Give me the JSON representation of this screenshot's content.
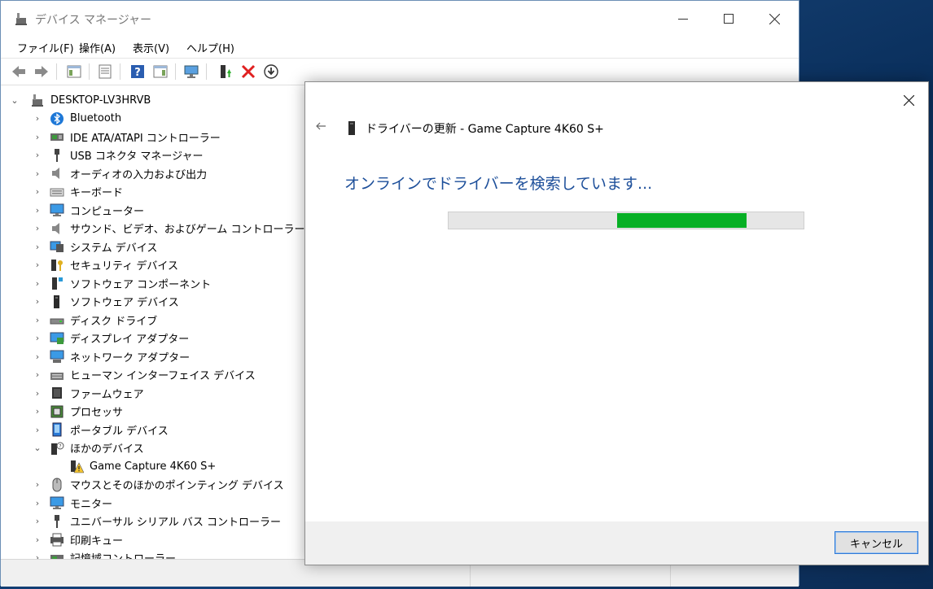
{
  "window": {
    "title": "デバイス マネージャー"
  },
  "menu": [
    "ファイル(F)",
    "操作(A)",
    "表示(V)",
    "ヘルプ(H)"
  ],
  "tree": {
    "root": "DESKTOP-LV3HRVB",
    "items": [
      {
        "label": "Bluetooth",
        "icon": "bluetooth-icon"
      },
      {
        "label": "IDE ATA/ATAPI コントローラー",
        "icon": "ide-controller-icon"
      },
      {
        "label": "USB コネクタ マネージャー",
        "icon": "usb-connector-icon"
      },
      {
        "label": "オーディオの入力および出力",
        "icon": "speaker-icon"
      },
      {
        "label": "キーボード",
        "icon": "keyboard-icon"
      },
      {
        "label": "コンピューター",
        "icon": "computer-icon"
      },
      {
        "label": "サウンド、ビデオ、およびゲーム コントローラー",
        "icon": "sound-icon"
      },
      {
        "label": "システム デバイス",
        "icon": "system-device-icon"
      },
      {
        "label": "セキュリティ デバイス",
        "icon": "security-key-icon"
      },
      {
        "label": "ソフトウェア コンポーネント",
        "icon": "software-component-icon"
      },
      {
        "label": "ソフトウェア デバイス",
        "icon": "software-device-icon"
      },
      {
        "label": "ディスク ドライブ",
        "icon": "disk-drive-icon"
      },
      {
        "label": "ディスプレイ アダプター",
        "icon": "display-adapter-icon"
      },
      {
        "label": "ネットワーク アダプター",
        "icon": "network-adapter-icon"
      },
      {
        "label": "ヒューマン インターフェイス デバイス",
        "icon": "hid-icon"
      },
      {
        "label": "ファームウェア",
        "icon": "firmware-icon"
      },
      {
        "label": "プロセッサ",
        "icon": "processor-icon"
      },
      {
        "label": "ポータブル デバイス",
        "icon": "portable-device-icon"
      },
      {
        "label": "ほかのデバイス",
        "icon": "unknown-device-icon"
      },
      {
        "label": "Game Capture 4K60 S+",
        "icon": "warning-device-icon"
      },
      {
        "label": "マウスとそのほかのポインティング デバイス",
        "icon": "mouse-icon"
      },
      {
        "label": "モニター",
        "icon": "monitor-icon"
      },
      {
        "label": "ユニバーサル シリアル バス コントローラー",
        "icon": "usb-controller-icon"
      },
      {
        "label": "印刷キュー",
        "icon": "printer-icon"
      },
      {
        "label": "記憶域コントローラー",
        "icon": "storage-controller-icon"
      }
    ]
  },
  "dialog": {
    "heading": "ドライバーの更新 - Game Capture 4K60 S+",
    "status": "オンラインでドライバーを検索しています...",
    "cancel_label": "キャンセル",
    "progress_start": 0.475,
    "progress_end": 0.84
  },
  "colors": {
    "accent_text": "#1d4f9a",
    "progress_fill": "#07b025"
  }
}
